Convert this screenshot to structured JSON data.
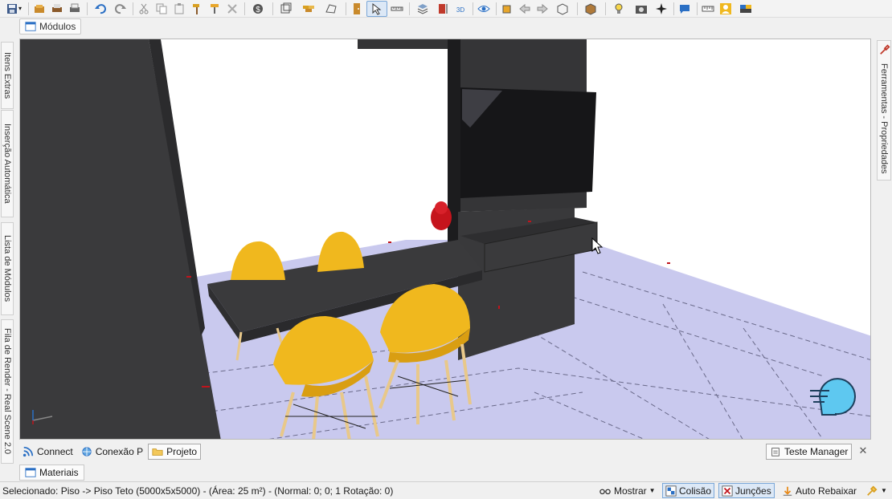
{
  "toolbar": {
    "items": [
      "save-icon",
      "open-icon",
      "print-preview-icon",
      "print-icon",
      "undo-icon",
      "redo-icon",
      "cut-icon",
      "copy-icon",
      "paste-icon",
      "hammer-icon",
      "paint-roller-icon",
      "delete-icon",
      "currency-icon",
      "module-frame-icon",
      "brick-wall-icon",
      "shape-icon",
      "door-icon",
      "pointer-icon",
      "measure-icon",
      "layers-icon",
      "dimension-icon",
      "3d-view-icon",
      "eye-icon",
      "rotate-icon",
      "arrow-left-icon",
      "arrow-right-icon",
      "box-view-icon",
      "cube-icon",
      "lamp-icon",
      "camera-icon",
      "target-icon",
      "chat-icon",
      "ruler-icon",
      "user-icon",
      "palette-icon"
    ]
  },
  "module_tab": {
    "label": "Módulos"
  },
  "left_tabs": [
    {
      "label": "Itens Extras"
    },
    {
      "label": "Inserção Automática"
    },
    {
      "label": "Lista de Módulos"
    },
    {
      "label": "Fila de Render - Real Scene 2.0"
    }
  ],
  "right_tab": {
    "label": "Ferramentas - Propriedades"
  },
  "bottom_tabs": [
    {
      "label": "Connect",
      "icon": "rss-icon"
    },
    {
      "label": "Conexão P",
      "icon": "globe-icon"
    },
    {
      "label": "Projeto",
      "icon": "folder-icon"
    }
  ],
  "teste_manager": {
    "label": "Teste Manager"
  },
  "materials_tab": {
    "label": "Materiais"
  },
  "status": {
    "text": "Selecionado: Piso -> Piso Teto (5000x5x5000) - (Área: 25 m²) - (Normal: 0; 0; 1 Rotação: 0)",
    "mostrar": "Mostrar",
    "colisao": "Colisão",
    "juncoes": "Junções",
    "auto_rebaixar": "Auto Rebaixar"
  },
  "colors": {
    "floor": "#c9c9ee",
    "wall": "#3a3a3c",
    "chair": "#f0b81e",
    "chat_bubble": "#5ec8f0"
  }
}
